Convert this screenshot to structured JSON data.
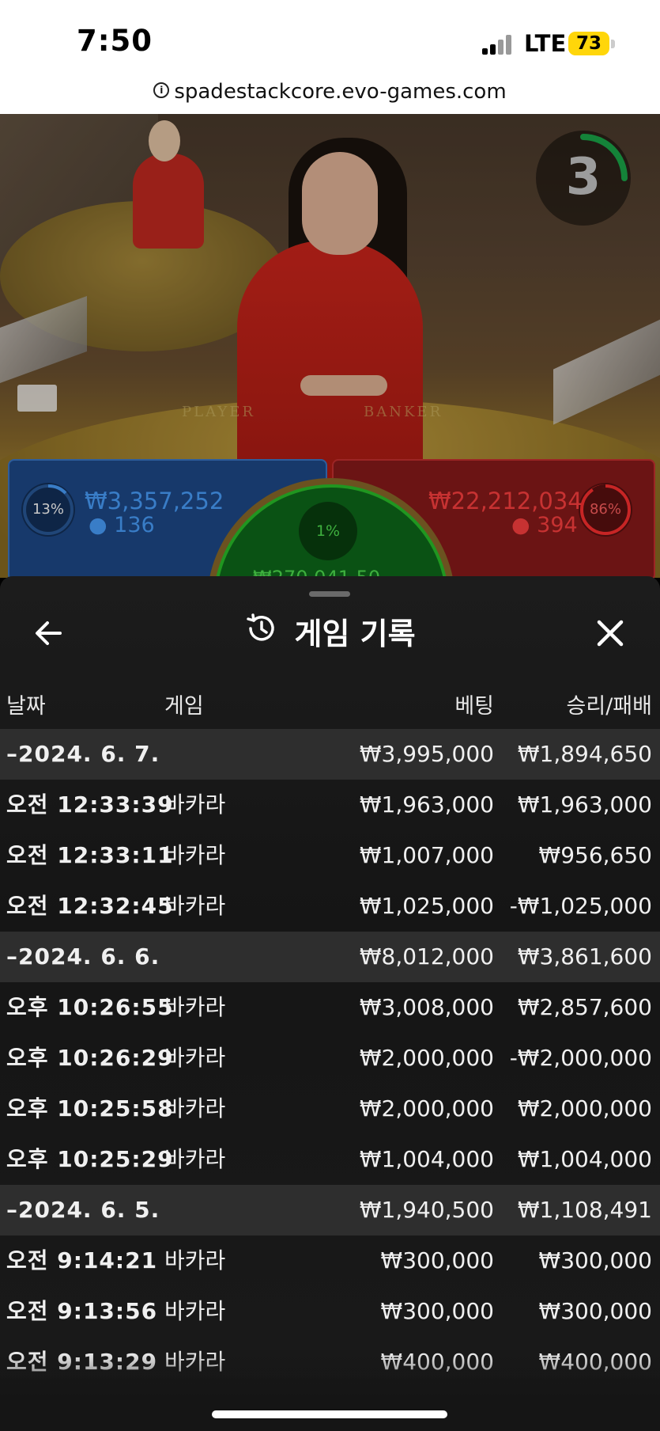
{
  "status": {
    "time": "7:50",
    "network": "LTE",
    "battery": "73"
  },
  "browser": {
    "url": "spadestackcore.evo-games.com"
  },
  "video": {
    "table_labels": [
      "PLAYER",
      "BANKER"
    ],
    "timer": "3",
    "player": {
      "pct": "13%",
      "amount": "₩3,357,252",
      "count": "136"
    },
    "banker": {
      "pct": "86%",
      "amount": "₩22,212,034",
      "count": "394"
    },
    "tie": {
      "pct": "1%",
      "amount": "₩270,041.50"
    }
  },
  "sheet": {
    "title": "게임 기록",
    "columns": {
      "date": "날짜",
      "game": "게임",
      "bet": "베팅",
      "result": "승리/패배"
    },
    "rows": [
      {
        "type": "date",
        "time": "–2024. 6. 7.",
        "game": "",
        "bet": "₩3,995,000",
        "result": "₩1,894,650"
      },
      {
        "type": "item",
        "time": "오전 12:33:39",
        "game": "바카라",
        "bet": "₩1,963,000",
        "result": "₩1,963,000"
      },
      {
        "type": "item",
        "time": "오전 12:33:11",
        "game": "바카라",
        "bet": "₩1,007,000",
        "result": "₩956,650"
      },
      {
        "type": "item",
        "time": "오전 12:32:45",
        "game": "바카라",
        "bet": "₩1,025,000",
        "result": "-₩1,025,000"
      },
      {
        "type": "date",
        "time": "–2024. 6. 6.",
        "game": "",
        "bet": "₩8,012,000",
        "result": "₩3,861,600"
      },
      {
        "type": "item",
        "time": "오후 10:26:55",
        "game": "바카라",
        "bet": "₩3,008,000",
        "result": "₩2,857,600"
      },
      {
        "type": "item",
        "time": "오후 10:26:29",
        "game": "바카라",
        "bet": "₩2,000,000",
        "result": "-₩2,000,000"
      },
      {
        "type": "item",
        "time": "오후 10:25:58",
        "game": "바카라",
        "bet": "₩2,000,000",
        "result": "₩2,000,000"
      },
      {
        "type": "item",
        "time": "오후 10:25:29",
        "game": "바카라",
        "bet": "₩1,004,000",
        "result": "₩1,004,000"
      },
      {
        "type": "date",
        "time": "–2024. 6. 5.",
        "game": "",
        "bet": "₩1,940,500",
        "result": "₩1,108,491"
      },
      {
        "type": "item",
        "time": "오전 9:14:21",
        "game": "바카라",
        "bet": "₩300,000",
        "result": "₩300,000"
      },
      {
        "type": "item",
        "time": "오전 9:13:56",
        "game": "바카라",
        "bet": "₩300,000",
        "result": "₩300,000"
      },
      {
        "type": "item",
        "time": "오전 9:13:29",
        "game": "바카라",
        "bet": "₩400,000",
        "result": "₩400,000"
      }
    ]
  }
}
